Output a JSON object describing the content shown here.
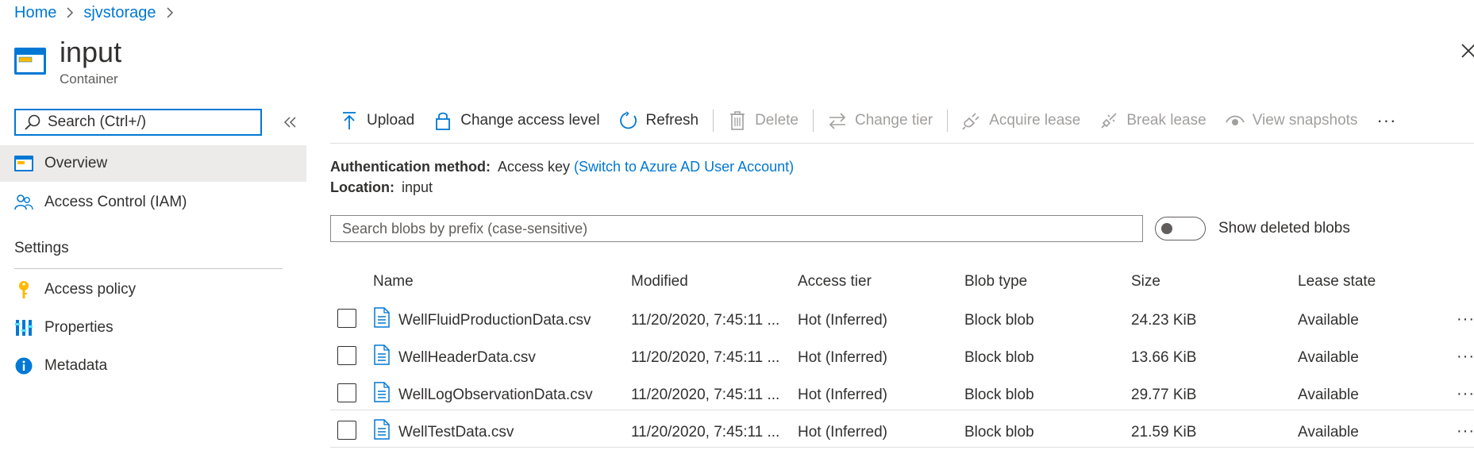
{
  "breadcrumb": [
    {
      "label": "Home"
    },
    {
      "label": "sjvstorage"
    }
  ],
  "header": {
    "title": "input",
    "subtitle": "Container"
  },
  "nav": {
    "search_placeholder": "Search (Ctrl+/)",
    "items": [
      {
        "label": "Overview",
        "icon": "container-icon",
        "selected": true
      },
      {
        "label": "Access Control (IAM)",
        "icon": "people-icon",
        "selected": false
      }
    ],
    "settings_header": "Settings",
    "settings_items": [
      {
        "label": "Access policy",
        "icon": "key-icon"
      },
      {
        "label": "Properties",
        "icon": "properties-icon"
      },
      {
        "label": "Metadata",
        "icon": "info-icon"
      }
    ]
  },
  "toolbar": {
    "upload": "Upload",
    "change_access": "Change access level",
    "refresh": "Refresh",
    "delete": "Delete",
    "change_tier": "Change tier",
    "acquire_lease": "Acquire lease",
    "break_lease": "Break lease",
    "view_snapshots": "View snapshots",
    "more": "···"
  },
  "info": {
    "auth_label": "Authentication method:",
    "auth_value": "Access key",
    "auth_link": "(Switch to Azure AD User Account)",
    "location_label": "Location:",
    "location_value": "input"
  },
  "blob_search": {
    "placeholder": "Search blobs by prefix (case-sensitive)"
  },
  "show_deleted": {
    "label": "Show deleted blobs",
    "on": false
  },
  "table": {
    "headers": [
      "Name",
      "Modified",
      "Access tier",
      "Blob type",
      "Size",
      "Lease state"
    ],
    "rows": [
      {
        "name": "WellFluidProductionData.csv",
        "modified": "11/20/2020, 7:45:11 ...",
        "tier": "Hot (Inferred)",
        "type": "Block blob",
        "size": "24.23 KiB",
        "lease": "Available"
      },
      {
        "name": "WellHeaderData.csv",
        "modified": "11/20/2020, 7:45:11 ...",
        "tier": "Hot (Inferred)",
        "type": "Block blob",
        "size": "13.66 KiB",
        "lease": "Available"
      },
      {
        "name": "WellLogObservationData.csv",
        "modified": "11/20/2020, 7:45:11 ...",
        "tier": "Hot (Inferred)",
        "type": "Block blob",
        "size": "29.77 KiB",
        "lease": "Available"
      },
      {
        "name": "WellTestData.csv",
        "modified": "11/20/2020, 7:45:11 ...",
        "tier": "Hot (Inferred)",
        "type": "Block blob",
        "size": "21.59 KiB",
        "lease": "Available"
      }
    ]
  },
  "colors": {
    "accent": "#0078d4",
    "selected_bg": "#edebe9",
    "disabled_text": "#a19f9d",
    "key_yellow": "#ffb900"
  }
}
